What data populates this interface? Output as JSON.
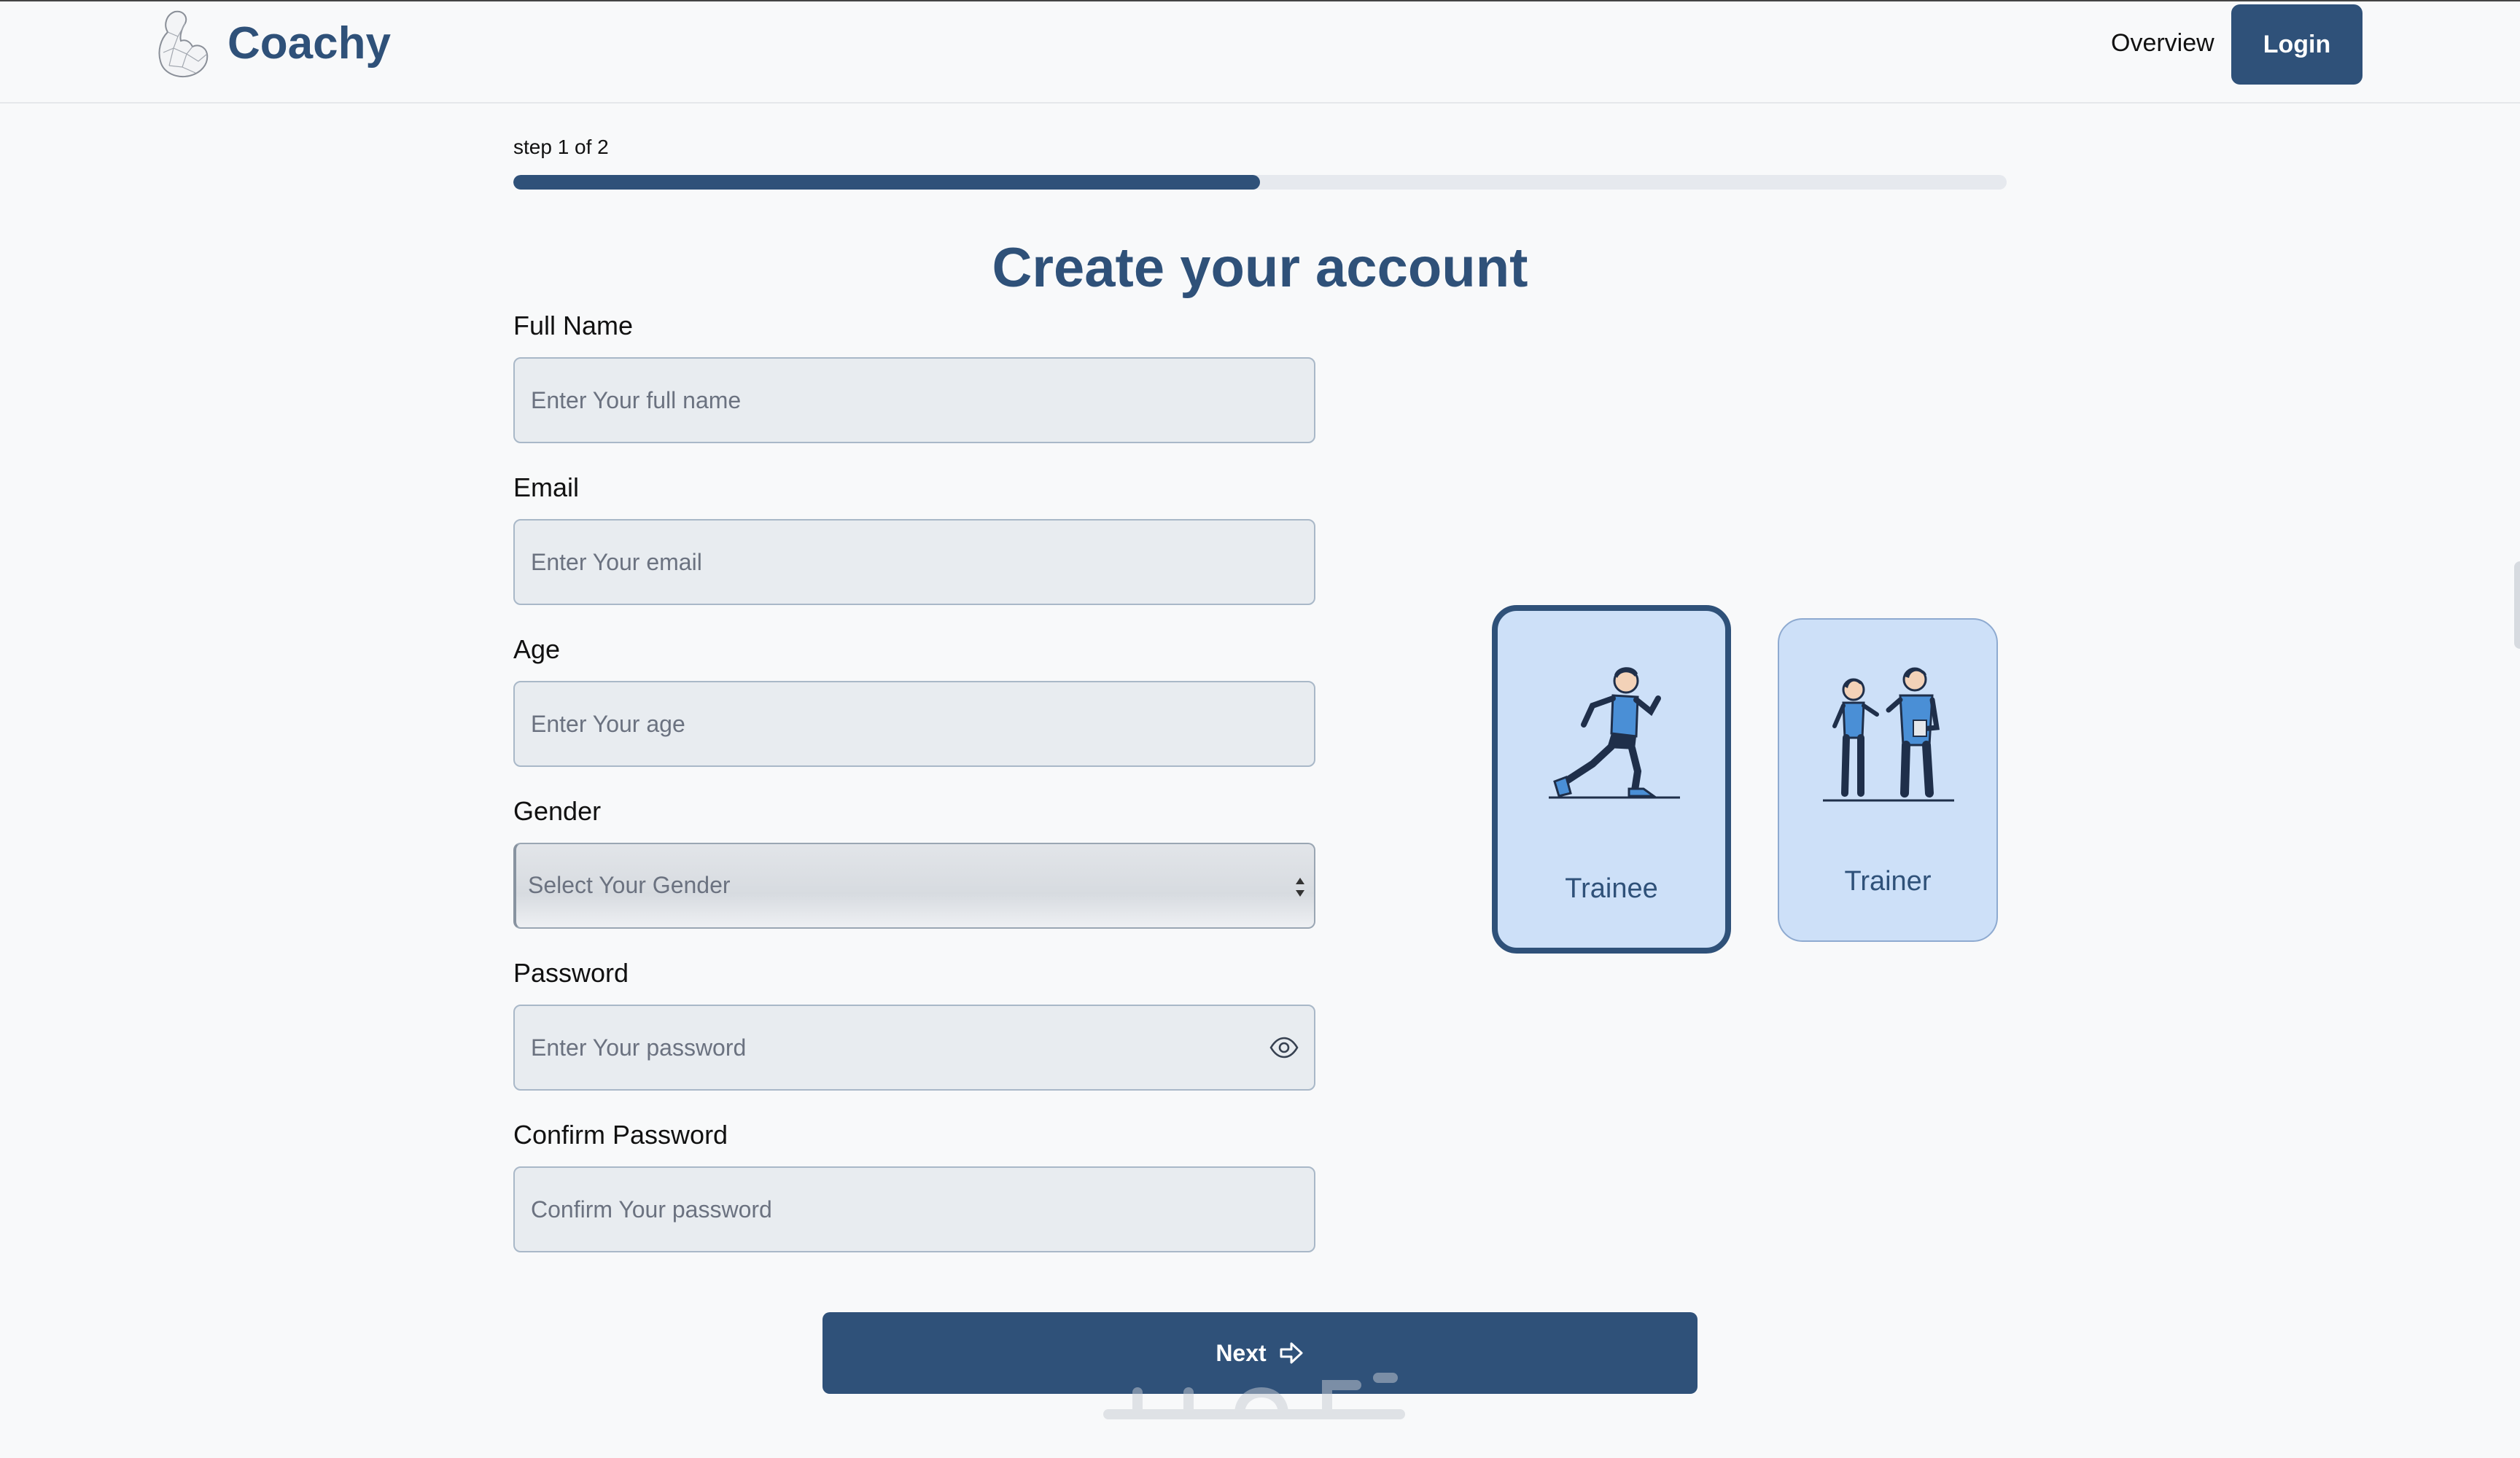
{
  "header": {
    "brand": "Coachy",
    "nav_overview": "Overview",
    "login_label": "Login"
  },
  "progress": {
    "step_text": "step 1 of 2",
    "fraction": 0.5
  },
  "form": {
    "title": "Create your account",
    "full_name": {
      "label": "Full Name",
      "placeholder": "Enter Your full name"
    },
    "email": {
      "label": "Email",
      "placeholder": "Enter Your email"
    },
    "age": {
      "label": "Age",
      "placeholder": "Enter Your age"
    },
    "gender": {
      "label": "Gender",
      "selected": "Select Your Gender"
    },
    "password": {
      "label": "Password",
      "placeholder": "Enter Your password"
    },
    "confirm_password": {
      "label": "Confirm Password",
      "placeholder": "Confirm Your password"
    },
    "next_label": "Next"
  },
  "roles": {
    "trainee": {
      "label": "Trainee",
      "selected": true,
      "icon": "runner-icon"
    },
    "trainer": {
      "label": "Trainer",
      "selected": false,
      "icon": "coach-icon"
    }
  },
  "colors": {
    "primary": "#2f5179",
    "card_bg": "#cde0f8",
    "field_bg": "#e8ecf0",
    "page_bg": "#f8f9fa"
  }
}
